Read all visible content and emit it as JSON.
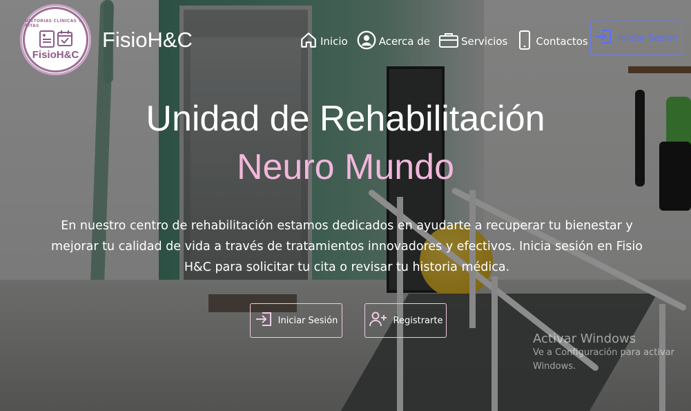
{
  "logo": {
    "arc_text": "HISTORIAS CLÍNICAS Y CITAS",
    "name": "FisioH&C"
  },
  "brand": {
    "name": "FisioH&C"
  },
  "nav": {
    "items": [
      {
        "label": "Inicio",
        "icon": "home-icon"
      },
      {
        "label": "Acerca de",
        "icon": "user-circle-icon"
      },
      {
        "label": "Servicios",
        "icon": "briefcase-icon"
      },
      {
        "label": "Contactos",
        "icon": "phone-icon"
      }
    ],
    "login_label": "Iniciar Sesión"
  },
  "hero": {
    "title": "Unidad de Rehabilitación",
    "subtitle": "Neuro Mundo",
    "description": "En nuestro centro de rehabilitación estamos dedicados en ayudarte a recuperar tu bienestar y mejorar tu calidad de vida a través de tratamientos innovadores y efectivos. Inicia sesión en Fisio H&C para solicitar tu cita o revisar tu historia médica.",
    "login_button": "Iniciar Sesión",
    "register_button": "Registrarte"
  },
  "watermark": {
    "title": "Activar Windows",
    "subtitle": "Ve a Configuración para activar Windows."
  },
  "colors": {
    "accent_pink": "#f2b7db",
    "accent_blue": "#5a6eff",
    "logo_purple": "#8a5b86"
  }
}
